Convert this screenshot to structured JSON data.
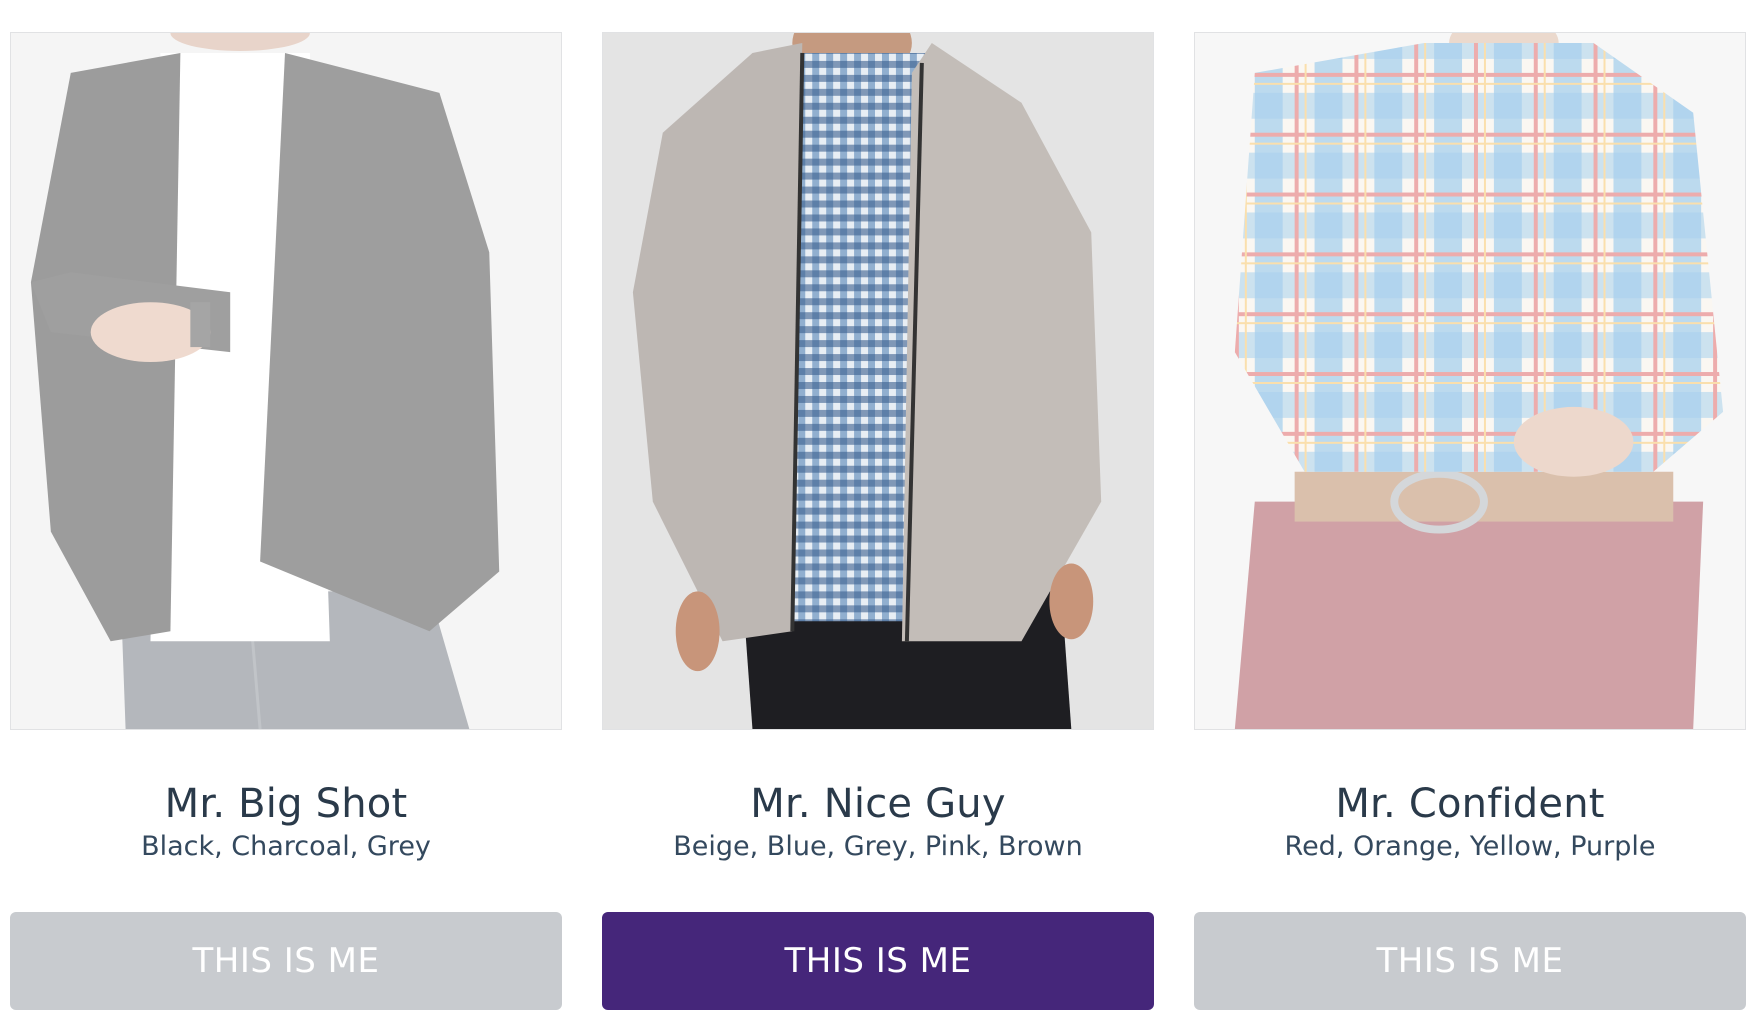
{
  "cards": [
    {
      "name": "Mr. Big Shot",
      "colors": "Black, Charcoal, Grey",
      "button_label": "THIS IS ME",
      "selected": false
    },
    {
      "name": "Mr. Nice Guy",
      "colors": "Beige, Blue, Grey, Pink, Brown",
      "button_label": "THIS IS ME",
      "selected": true
    },
    {
      "name": "Mr. Confident",
      "colors": "Red, Orange, Yellow, Purple",
      "button_label": "THIS IS ME",
      "selected": false
    }
  ],
  "theme": {
    "accent": "#45267a",
    "inactive_button": "#c8cbcf",
    "text": "#2a3a4a"
  }
}
